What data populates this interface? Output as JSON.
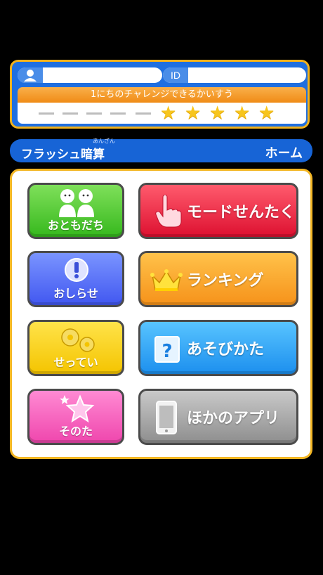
{
  "profile": {
    "user_icon": "person-icon",
    "user_name": "",
    "id_label": "ID",
    "id_value": ""
  },
  "challenge": {
    "label": "1にちのチャレンジできるかいすう",
    "stars_filled": 5,
    "dashes_empty": 5
  },
  "header": {
    "app_title": "フラッシュ暗算",
    "title_ruby": "あんざん",
    "screen_title": "ホーム"
  },
  "menu": {
    "friends": {
      "label": "おともだち",
      "icon": "two-people-icon"
    },
    "mode_select": {
      "label": "モードせんたく",
      "icon": "pointing-hand-icon"
    },
    "news": {
      "label": "おしらせ",
      "icon": "exclamation-icon"
    },
    "ranking": {
      "label": "ランキング",
      "icon": "crown-icon"
    },
    "settings": {
      "label": "せってい",
      "icon": "gears-icon"
    },
    "how_to_play": {
      "label": "あそびかた",
      "icon": "question-icon"
    },
    "other": {
      "label": "そのた",
      "icon": "star-icon"
    },
    "other_apps": {
      "label": "ほかのアプリ",
      "icon": "smartphone-icon"
    }
  },
  "colors": {
    "frame_gold": "#f3b623",
    "header_blue": "#1764d6",
    "star_yellow": "#f7c51d"
  }
}
